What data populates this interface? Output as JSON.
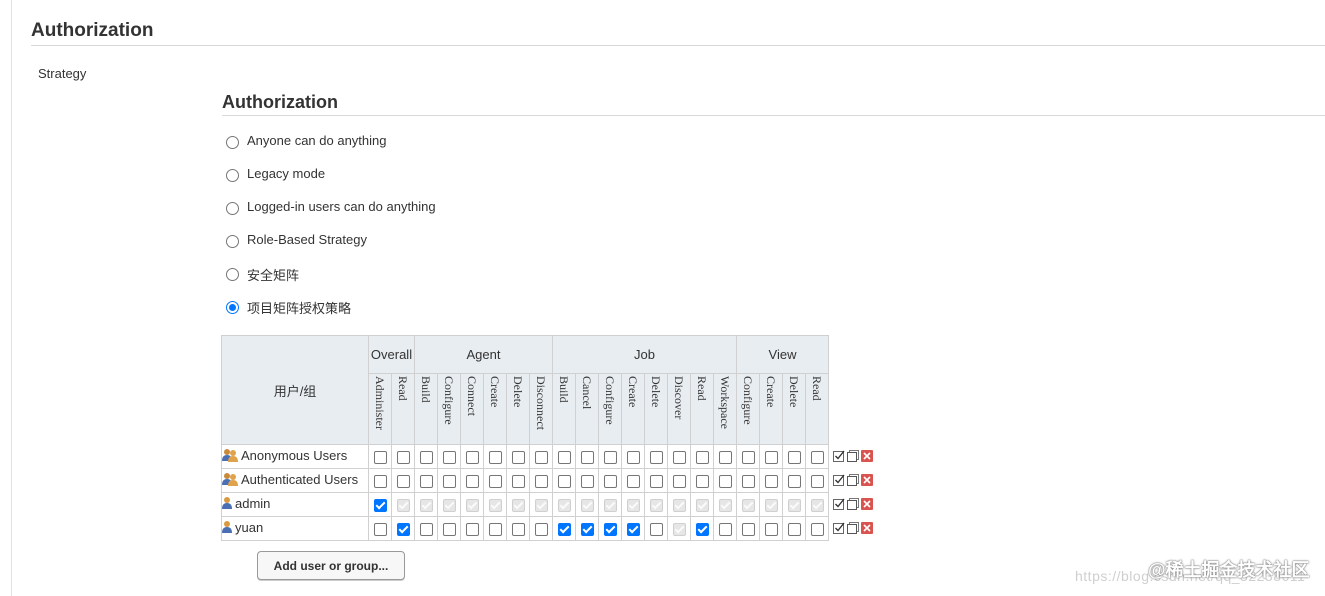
{
  "section": {
    "title": "Authorization",
    "strategy_label": "Strategy"
  },
  "authorization": {
    "title": "Authorization",
    "options": [
      {
        "label": "Anyone can do anything",
        "selected": false
      },
      {
        "label": "Legacy mode",
        "selected": false
      },
      {
        "label": "Logged-in users can do anything",
        "selected": false
      },
      {
        "label": "Role-Based Strategy",
        "selected": false
      },
      {
        "label": "安全矩阵",
        "selected": false
      },
      {
        "label": "项目矩阵授权策略",
        "selected": true
      }
    ]
  },
  "matrix": {
    "user_header": "用户/组",
    "groups": [
      {
        "label": "Overall",
        "span": 2
      },
      {
        "label": "Agent",
        "span": 6
      },
      {
        "label": "Job",
        "span": 8
      },
      {
        "label": "View",
        "span": 4
      }
    ],
    "permissions": [
      "Administer",
      "Read",
      "Build",
      "Configure",
      "Connect",
      "Create",
      "Delete",
      "Disconnect",
      "Build",
      "Cancel",
      "Configure",
      "Create",
      "Delete",
      "Discover",
      "Read",
      "Workspace",
      "Configure",
      "Create",
      "Delete",
      "Read"
    ],
    "rows": [
      {
        "name": "Anonymous Users",
        "icon": "group-icon",
        "cells": [
          "u",
          "u",
          "u",
          "u",
          "u",
          "u",
          "u",
          "u",
          "u",
          "u",
          "u",
          "u",
          "u",
          "u",
          "u",
          "u",
          "u",
          "u",
          "u",
          "u"
        ]
      },
      {
        "name": "Authenticated Users",
        "icon": "group-icon",
        "cells": [
          "u",
          "u",
          "u",
          "u",
          "u",
          "u",
          "u",
          "u",
          "u",
          "u",
          "u",
          "u",
          "u",
          "u",
          "u",
          "u",
          "u",
          "u",
          "u",
          "u"
        ]
      },
      {
        "name": "admin",
        "icon": "user-icon",
        "cells": [
          "c",
          "d",
          "d",
          "d",
          "d",
          "d",
          "d",
          "d",
          "d",
          "d",
          "d",
          "d",
          "d",
          "d",
          "d",
          "d",
          "d",
          "d",
          "d",
          "d"
        ]
      },
      {
        "name": "yuan",
        "icon": "user-icon",
        "cells": [
          "u",
          "c",
          "u",
          "u",
          "u",
          "u",
          "u",
          "u",
          "c",
          "c",
          "c",
          "c",
          "u",
          "d",
          "c",
          "u",
          "u",
          "u",
          "u",
          "u"
        ]
      }
    ],
    "row_actions": [
      "select-all-icon",
      "unselect-all-icon",
      "remove-icon"
    ]
  },
  "add_button_label": "Add user or group...",
  "watermark": {
    "url": "https://blog.csdn.net/qq_32238611",
    "brand": "@稀土掘金技术社区"
  },
  "colors": {
    "accent": "#0075ff",
    "header_bg": "#e8edf1",
    "remove": "#d9534f"
  }
}
